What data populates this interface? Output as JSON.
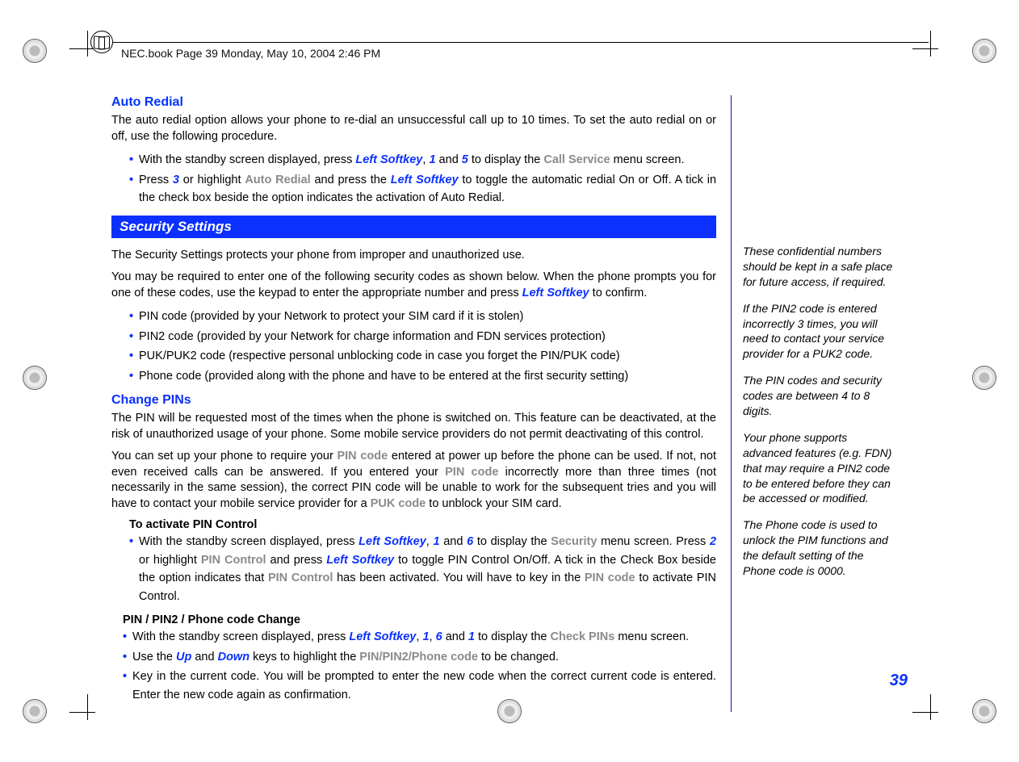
{
  "header": {
    "running_head": "NEC.book  Page 39  Monday, May 10, 2004  2:46 PM"
  },
  "page_number": "39",
  "tokens": {
    "left_softkey": "Left Softkey",
    "one": "1",
    "two": "2",
    "three": "3",
    "five": "5",
    "six": "6",
    "up": "Up",
    "down": "Down"
  },
  "auto_redial": {
    "title": "Auto Redial",
    "intro": "The auto redial option allows your phone to re-dial an unsuccessful call up to 10 times. To set the auto redial on or off, use the following procedure.",
    "b1_a": "With the standby screen displayed, press ",
    "b1_b": ", ",
    "b1_c": " and ",
    "b1_d": " to display the ",
    "b1_menu": "Call Service",
    "b1_e": " menu screen.",
    "b2_a": "Press ",
    "b2_b": " or highlight ",
    "b2_opt": "Auto Redial",
    "b2_c": " and press the ",
    "b2_d": " to toggle the automatic redial On or Off. A tick in the check box beside the option indicates the activation of Auto Redial."
  },
  "security": {
    "bar": "Security Settings",
    "p1": "The Security Settings protects your phone from improper and unauthorized use.",
    "p2_a": "You may be required to enter one of the following security codes as shown below. When the phone prompts you for one of these codes, use the keypad to enter the appropriate number and press ",
    "p2_b": " to confirm.",
    "codes": [
      "PIN code (provided by your Network to protect your SIM card if it is stolen)",
      "PIN2 code (provided by your Network for charge information and FDN services protection)",
      "PUK/PUK2  code (respective personal unblocking code in case you forget the PIN/PUK code)",
      "Phone code (provided along with the phone and have to be entered at the first security setting)"
    ]
  },
  "change_pins": {
    "title": "Change PINs",
    "p1": "The PIN will be requested most of the times when the phone is switched on. This feature can be deactivated, at the risk of unauthorized usage of your phone. Some mobile service providers do not permit deactivating of this control.",
    "p2_a": "You can set up your phone to require your ",
    "pin_code": "PIN code",
    "p2_b": " entered at power up before the phone can be used. If not, not even received calls can be answered. If you entered your ",
    "p2_c": " incorrectly more than three times (not necessarily in the same session), the correct PIN code will be unable to work for the subsequent tries and you will have to contact your mobile service provider for a ",
    "puk_code": "PUK code",
    "p2_d": " to unblock your SIM card.",
    "activate_head": "To activate PIN Control",
    "act_a": "With the standby screen displayed, press ",
    "act_b": ", ",
    "act_c": " and ",
    "act_d": " to display the ",
    "sec_menu": "Security",
    "act_e": " menu screen. Press ",
    "act_f": " or highlight ",
    "pin_control": "PIN Control",
    "act_g": " and press ",
    "act_h": " to toggle PIN Control On/Off. A tick in the Check Box beside the option indicates that ",
    "act_i": " has been activated. You will have to key in the ",
    "act_j": " to activate PIN Control.",
    "change_head": "PIN / PIN2 / Phone code Change",
    "ch1_a": "With the standby screen displayed, press ",
    "ch1_b": ", ",
    "ch1_c": ", ",
    "ch1_d": " and ",
    "ch1_e": " to display the ",
    "check_pins": "Check PINs",
    "ch1_f": " menu screen.",
    "ch2_a": "Use the ",
    "ch2_b": " and ",
    "ch2_c": " keys to highlight the ",
    "pin_pin2_phone": "PIN/PIN2/Phone code",
    "ch2_d": " to be changed.",
    "ch3": "Key in the current code. You will be prompted to enter the new code when the correct current code is entered. Enter the new code again as confirmation."
  },
  "side_notes": {
    "n1": "These confidential numbers should be kept in a safe place for future access, if required.",
    "n2": "If the PIN2 code is entered incorrectly 3 times, you will need to contact your service provider for a PUK2 code.",
    "n3": "The PIN codes and security codes are between 4 to 8 digits.",
    "n4": "Your phone supports advanced features (e.g. FDN) that may require a PIN2 code to be entered before they can be accessed or modified.",
    "n5": "The Phone code is used to unlock the PIM functions and the default setting of the Phone code is 0000."
  }
}
